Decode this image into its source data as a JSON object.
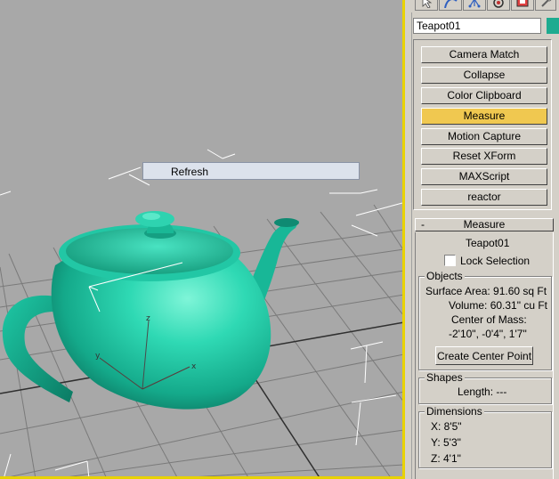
{
  "viewport": {
    "context_menu": {
      "refresh_label": "Refresh"
    },
    "axis_labels": {
      "z": "z",
      "x": "x",
      "y": "y"
    }
  },
  "command_panel": {
    "tabs": [
      {
        "icon": "cursor-icon"
      },
      {
        "icon": "bend-icon"
      },
      {
        "icon": "hierarchy-icon"
      },
      {
        "icon": "motion-icon"
      },
      {
        "icon": "display-icon"
      },
      {
        "icon": "utilities-icon"
      }
    ],
    "object_name": "Teapot01",
    "object_color": "#1eab90",
    "utilities": [
      {
        "label": "Camera Match",
        "active": false
      },
      {
        "label": "Collapse",
        "active": false
      },
      {
        "label": "Color Clipboard",
        "active": false
      },
      {
        "label": "Measure",
        "active": true
      },
      {
        "label": "Motion Capture",
        "active": false
      },
      {
        "label": "Reset XForm",
        "active": false
      },
      {
        "label": "MAXScript",
        "active": false
      },
      {
        "label": "reactor",
        "active": false
      }
    ],
    "measure": {
      "collapse_symbol": "-",
      "title": "Measure",
      "object_name": "Teapot01",
      "lock_selection_label": "Lock Selection",
      "objects_group": "Objects",
      "surface_area": "Surface Area:  91.60 sq Ft",
      "volume": "Volume:  60.31\" cu Ft",
      "center_of_mass_label": "Center of Mass:",
      "center_of_mass_value": "-2'10\", -0'4\", 1'7\"",
      "create_center_point": "Create Center Point",
      "shapes_group": "Shapes",
      "length": "Length:  ---",
      "dimensions_group": "Dimensions",
      "dim_x": "X:  8'5\"",
      "dim_y": "Y:  5'3\"",
      "dim_z": "Z:  4'1\""
    }
  },
  "colors": {
    "viewport_bg": "#a8a8a8",
    "grid": "#7a7a7a",
    "teapot": "#1eab90",
    "active_border": "#e8d200",
    "active_button": "#f0c850"
  }
}
